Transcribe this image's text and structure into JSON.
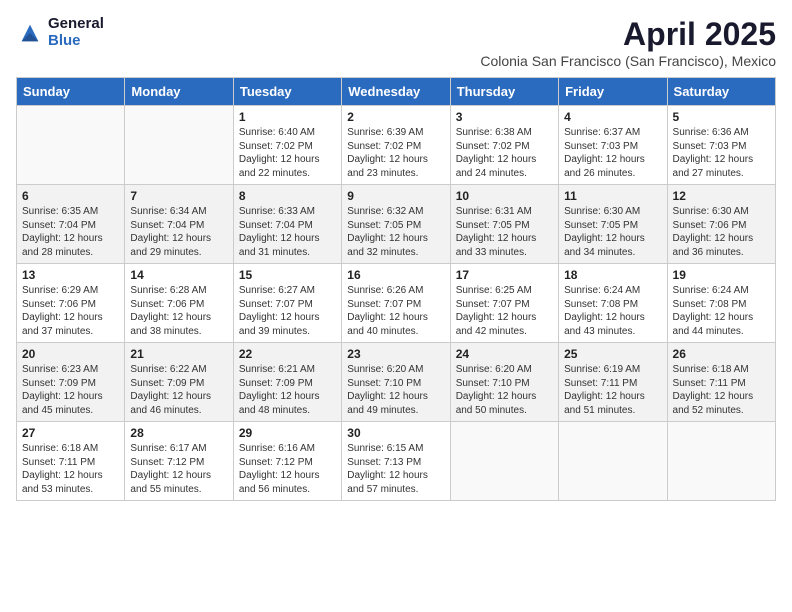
{
  "logo": {
    "general": "General",
    "blue": "Blue"
  },
  "title": "April 2025",
  "subtitle": "Colonia San Francisco (San Francisco), Mexico",
  "days_of_week": [
    "Sunday",
    "Monday",
    "Tuesday",
    "Wednesday",
    "Thursday",
    "Friday",
    "Saturday"
  ],
  "weeks": [
    [
      {
        "day": "",
        "info": ""
      },
      {
        "day": "",
        "info": ""
      },
      {
        "day": "1",
        "info": "Sunrise: 6:40 AM\nSunset: 7:02 PM\nDaylight: 12 hours and 22 minutes."
      },
      {
        "day": "2",
        "info": "Sunrise: 6:39 AM\nSunset: 7:02 PM\nDaylight: 12 hours and 23 minutes."
      },
      {
        "day": "3",
        "info": "Sunrise: 6:38 AM\nSunset: 7:02 PM\nDaylight: 12 hours and 24 minutes."
      },
      {
        "day": "4",
        "info": "Sunrise: 6:37 AM\nSunset: 7:03 PM\nDaylight: 12 hours and 26 minutes."
      },
      {
        "day": "5",
        "info": "Sunrise: 6:36 AM\nSunset: 7:03 PM\nDaylight: 12 hours and 27 minutes."
      }
    ],
    [
      {
        "day": "6",
        "info": "Sunrise: 6:35 AM\nSunset: 7:04 PM\nDaylight: 12 hours and 28 minutes."
      },
      {
        "day": "7",
        "info": "Sunrise: 6:34 AM\nSunset: 7:04 PM\nDaylight: 12 hours and 29 minutes."
      },
      {
        "day": "8",
        "info": "Sunrise: 6:33 AM\nSunset: 7:04 PM\nDaylight: 12 hours and 31 minutes."
      },
      {
        "day": "9",
        "info": "Sunrise: 6:32 AM\nSunset: 7:05 PM\nDaylight: 12 hours and 32 minutes."
      },
      {
        "day": "10",
        "info": "Sunrise: 6:31 AM\nSunset: 7:05 PM\nDaylight: 12 hours and 33 minutes."
      },
      {
        "day": "11",
        "info": "Sunrise: 6:30 AM\nSunset: 7:05 PM\nDaylight: 12 hours and 34 minutes."
      },
      {
        "day": "12",
        "info": "Sunrise: 6:30 AM\nSunset: 7:06 PM\nDaylight: 12 hours and 36 minutes."
      }
    ],
    [
      {
        "day": "13",
        "info": "Sunrise: 6:29 AM\nSunset: 7:06 PM\nDaylight: 12 hours and 37 minutes."
      },
      {
        "day": "14",
        "info": "Sunrise: 6:28 AM\nSunset: 7:06 PM\nDaylight: 12 hours and 38 minutes."
      },
      {
        "day": "15",
        "info": "Sunrise: 6:27 AM\nSunset: 7:07 PM\nDaylight: 12 hours and 39 minutes."
      },
      {
        "day": "16",
        "info": "Sunrise: 6:26 AM\nSunset: 7:07 PM\nDaylight: 12 hours and 40 minutes."
      },
      {
        "day": "17",
        "info": "Sunrise: 6:25 AM\nSunset: 7:07 PM\nDaylight: 12 hours and 42 minutes."
      },
      {
        "day": "18",
        "info": "Sunrise: 6:24 AM\nSunset: 7:08 PM\nDaylight: 12 hours and 43 minutes."
      },
      {
        "day": "19",
        "info": "Sunrise: 6:24 AM\nSunset: 7:08 PM\nDaylight: 12 hours and 44 minutes."
      }
    ],
    [
      {
        "day": "20",
        "info": "Sunrise: 6:23 AM\nSunset: 7:09 PM\nDaylight: 12 hours and 45 minutes."
      },
      {
        "day": "21",
        "info": "Sunrise: 6:22 AM\nSunset: 7:09 PM\nDaylight: 12 hours and 46 minutes."
      },
      {
        "day": "22",
        "info": "Sunrise: 6:21 AM\nSunset: 7:09 PM\nDaylight: 12 hours and 48 minutes."
      },
      {
        "day": "23",
        "info": "Sunrise: 6:20 AM\nSunset: 7:10 PM\nDaylight: 12 hours and 49 minutes."
      },
      {
        "day": "24",
        "info": "Sunrise: 6:20 AM\nSunset: 7:10 PM\nDaylight: 12 hours and 50 minutes."
      },
      {
        "day": "25",
        "info": "Sunrise: 6:19 AM\nSunset: 7:11 PM\nDaylight: 12 hours and 51 minutes."
      },
      {
        "day": "26",
        "info": "Sunrise: 6:18 AM\nSunset: 7:11 PM\nDaylight: 12 hours and 52 minutes."
      }
    ],
    [
      {
        "day": "27",
        "info": "Sunrise: 6:18 AM\nSunset: 7:11 PM\nDaylight: 12 hours and 53 minutes."
      },
      {
        "day": "28",
        "info": "Sunrise: 6:17 AM\nSunset: 7:12 PM\nDaylight: 12 hours and 55 minutes."
      },
      {
        "day": "29",
        "info": "Sunrise: 6:16 AM\nSunset: 7:12 PM\nDaylight: 12 hours and 56 minutes."
      },
      {
        "day": "30",
        "info": "Sunrise: 6:15 AM\nSunset: 7:13 PM\nDaylight: 12 hours and 57 minutes."
      },
      {
        "day": "",
        "info": ""
      },
      {
        "day": "",
        "info": ""
      },
      {
        "day": "",
        "info": ""
      }
    ]
  ]
}
